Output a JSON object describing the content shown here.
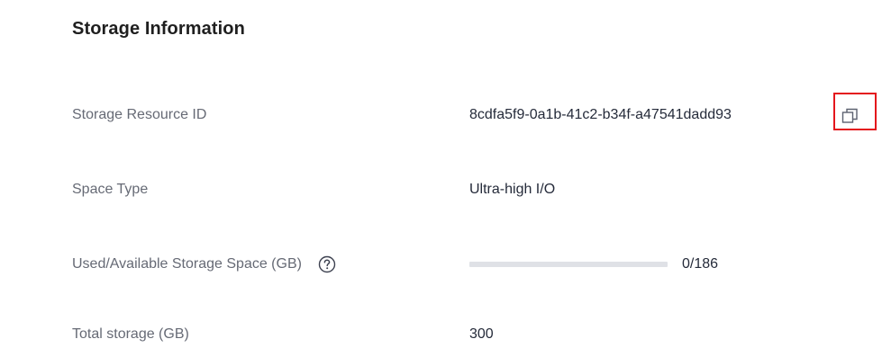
{
  "section": {
    "title": "Storage Information"
  },
  "rows": {
    "resource_id": {
      "label": "Storage Resource ID",
      "value": "8cdfa5f9-0a1b-41c2-b34f-a47541dadd93",
      "copy_icon": "copy-icon"
    },
    "space_type": {
      "label": "Space Type",
      "value": "Ultra-high I/O"
    },
    "usage": {
      "label": "Used/Available Storage Space (GB)",
      "help_icon": "question-circle-icon",
      "used": 0,
      "available": 186,
      "text": "0/186",
      "fill_fraction": 0
    },
    "total": {
      "label": "Total storage (GB)",
      "value": "300"
    }
  },
  "colors": {
    "label": "#666a75",
    "value": "#252b3a",
    "highlight_border": "#e4161c",
    "progress_track": "#dfe1e6"
  }
}
